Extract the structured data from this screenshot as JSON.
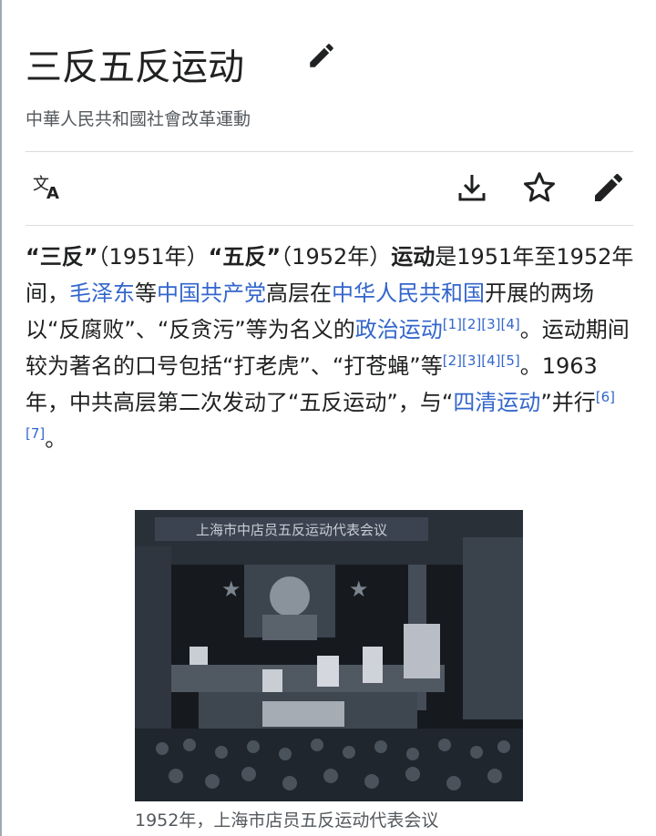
{
  "page": {
    "title": "三反五反运动",
    "subtitle": "中華人民共和國社會改革運動"
  },
  "toolbar": {
    "language": "language-icon",
    "download": "download-icon",
    "watch": "star-icon",
    "edit": "pencil-icon"
  },
  "article": {
    "p1_bold1": "“三反”",
    "p1_t1": "（1951年）",
    "p1_bold2": "“五反”",
    "p1_t2": "（1952年）",
    "p1_bold3": "运动",
    "p1_t3": "是1951年至1952年间，",
    "link_mao": "毛泽东",
    "p1_t4": "等",
    "link_ccp": "中国共产党",
    "p1_t5": "高层在",
    "link_prc": "中华人民共和国",
    "p1_t6": "开展的两场以“反腐败”、“反贪污”等为名义的",
    "link_politics": "政治运动",
    "refs1": [
      "[1]",
      "[2]",
      "[3]",
      "[4]"
    ],
    "p1_t7": "。运动期间较为著名的口号包括“打老虎”、“打苍蝇”等",
    "refs2": [
      "[2]",
      "[3]",
      "[4]",
      "[5]"
    ],
    "p1_t8": "。1963年，中共高层第二次发动了“五反运动”，与“",
    "link_siqing": "四清运动",
    "p1_t9": "”并行",
    "refs3": [
      "[6]",
      "[7]"
    ],
    "p1_t10": "。"
  },
  "figure": {
    "banner": "上海市中店员五反运动代表会议",
    "caption": "1952年，上海市店员五反运动代表会议"
  },
  "colors": {
    "link": "#3366cc",
    "text": "#202122",
    "muted": "#54595d"
  }
}
